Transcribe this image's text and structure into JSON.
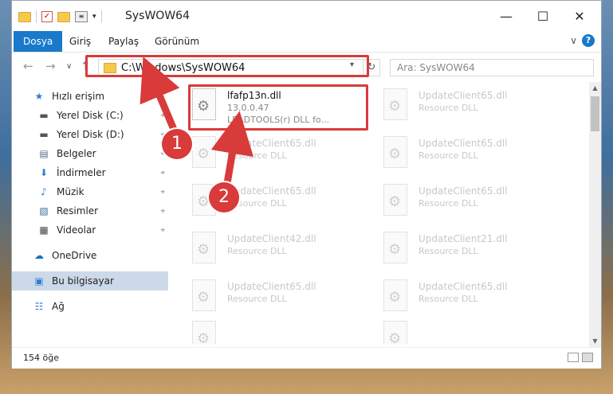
{
  "window": {
    "title": "SysWOW64",
    "minimize": "—",
    "maximize": "☐",
    "close": "✕"
  },
  "ribbon": {
    "tabs": [
      {
        "label": "Dosya"
      },
      {
        "label": "Giriş"
      },
      {
        "label": "Paylaş"
      },
      {
        "label": "Görünüm"
      }
    ],
    "expand": "∨",
    "help": "?"
  },
  "nav": {
    "back": "←",
    "forward": "→",
    "recent": "∨",
    "up": "↑",
    "path": "C:\\Windows\\SysWOW64",
    "refresh": "↻",
    "search_placeholder": "Ara: SysWOW64"
  },
  "sidebar": {
    "items": [
      {
        "label": "Hızlı erişim",
        "icon": "star-icon",
        "glyph": "★",
        "color": "#2f7fd6"
      },
      {
        "label": "Yerel Disk (C:)",
        "icon": "drive-icon",
        "glyph": "▬",
        "color": "#555555",
        "pinned": true
      },
      {
        "label": "Yerel Disk (D:)",
        "icon": "drive-icon",
        "glyph": "▬",
        "color": "#555555",
        "pinned": true
      },
      {
        "label": "Belgeler",
        "icon": "documents-icon",
        "glyph": "▤",
        "color": "#5a6f8a",
        "pinned": true
      },
      {
        "label": "İndirmeler",
        "icon": "downloads-icon",
        "glyph": "⬇",
        "color": "#2f7fd6",
        "pinned": true
      },
      {
        "label": "Müzik",
        "icon": "music-icon",
        "glyph": "♪",
        "color": "#2f7fd6",
        "pinned": true
      },
      {
        "label": "Resimler",
        "icon": "pictures-icon",
        "glyph": "▧",
        "color": "#3a6d9a",
        "pinned": true
      },
      {
        "label": "Videolar",
        "icon": "videos-icon",
        "glyph": "▦",
        "color": "#444444",
        "pinned": true
      },
      {
        "label": "OneDrive",
        "icon": "cloud-icon",
        "glyph": "☁",
        "color": "#1a6fc7"
      },
      {
        "label": "Bu bilgisayar",
        "icon": "computer-icon",
        "glyph": "▣",
        "color": "#2f7fd6",
        "selected": true
      },
      {
        "label": "Ağ",
        "icon": "network-icon",
        "glyph": "☷",
        "color": "#2f7fd6"
      }
    ],
    "pin_glyph": "⌖"
  },
  "files": {
    "highlighted": {
      "name": "lfafp13n.dll",
      "version": "13.0.0.47",
      "description": "LEADTOOLS(r) DLL fo..."
    },
    "ghosts": [
      {
        "name": "UpdateClient65.dll",
        "type": "Resource DLL"
      },
      {
        "name": "UpdateClient65.dll",
        "type": "Resource DLL"
      },
      {
        "name": "UpdateClient65.dll",
        "type": "Resource DLL"
      },
      {
        "name": "UpdateClient65.dll",
        "type": "Resource DLL"
      },
      {
        "name": "UpdateClient65.dll",
        "type": "Resource DLL"
      },
      {
        "name": "UpdateClient65.dll",
        "type": "Resource DLL"
      },
      {
        "name": "UpdateClient42.dll",
        "type": "Resource DLL"
      },
      {
        "name": "UpdateClient21.dll",
        "type": "Resource DLL"
      },
      {
        "name": "UpdateClient65.dll",
        "type": "Resource DLL"
      },
      {
        "name": "UpdateClient65.dll",
        "type": "Resource DLL"
      }
    ]
  },
  "status": {
    "count": "154 öğe"
  },
  "annotations": {
    "badge1": "1",
    "badge2": "2",
    "color": "#d93a3a"
  }
}
